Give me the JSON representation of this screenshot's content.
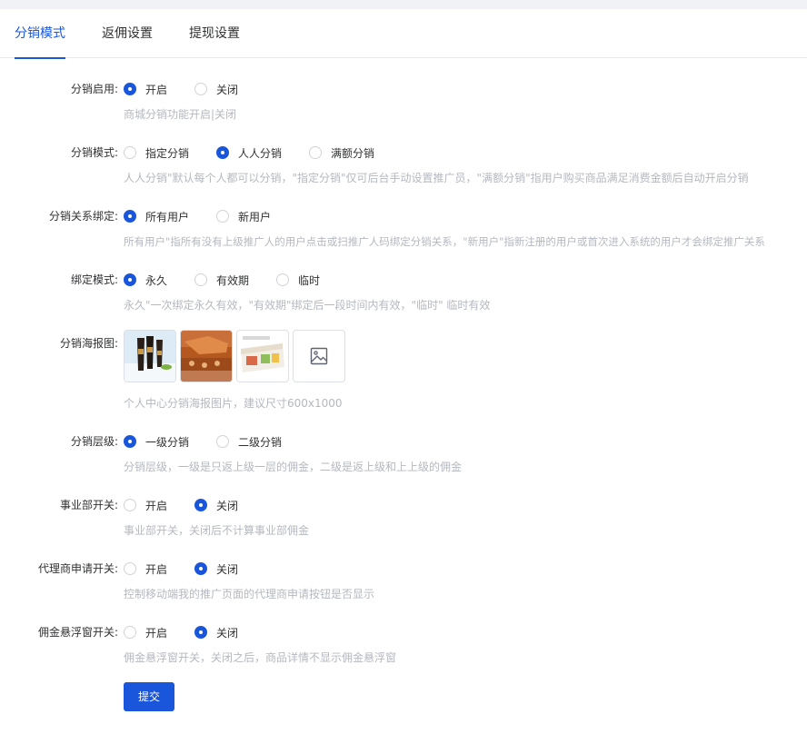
{
  "tabs": [
    {
      "label": "分销模式",
      "active": true
    },
    {
      "label": "返佣设置",
      "active": false
    },
    {
      "label": "提现设置",
      "active": false
    }
  ],
  "form": {
    "enable": {
      "label": "分销启用:",
      "options": [
        "开启",
        "关闭"
      ],
      "selected": 0,
      "hint": "商城分销功能开启|关闭"
    },
    "mode": {
      "label": "分销模式:",
      "options": [
        "指定分销",
        "人人分销",
        "满额分销"
      ],
      "selected": 1,
      "hint": "人人分销\"默认每个人都可以分销，\"指定分销\"仅可后台手动设置推广员，\"满额分销\"指用户购买商品满足消费金额后自动开启分销"
    },
    "binding": {
      "label": "分销关系绑定:",
      "options": [
        "所有用户",
        "新用户"
      ],
      "selected": 0,
      "hint": "所有用户\"指所有没有上级推广人的用户点击或扫推广人码绑定分销关系，\"新用户\"指新注册的用户或首次进入系统的用户才会绑定推广关系"
    },
    "bind_mode": {
      "label": "绑定模式:",
      "options": [
        "永久",
        "有效期",
        "临时"
      ],
      "selected": 0,
      "hint": "永久\"一次绑定永久有效，\"有效期\"绑定后一段时间内有效，\"临时\" 临时有效"
    },
    "poster": {
      "label": "分销海报图:",
      "hint": "个人中心分销海报图片，建议尺寸600x1000"
    },
    "level": {
      "label": "分销层级:",
      "options": [
        "一级分销",
        "二级分销"
      ],
      "selected": 0,
      "hint": "分销层级，一级是只返上级一层的佣金，二级是返上级和上上级的佣金"
    },
    "division": {
      "label": "事业部开关:",
      "options": [
        "开启",
        "关闭"
      ],
      "selected": 1,
      "hint": "事业部开关，关闭后不计算事业部佣金"
    },
    "agent": {
      "label": "代理商申请开关:",
      "options": [
        "开启",
        "关闭"
      ],
      "selected": 1,
      "hint": "控制移动端我的推广页面的代理商申请按钮是否显示"
    },
    "float": {
      "label": "佣金悬浮窗开关:",
      "options": [
        "开启",
        "关闭"
      ],
      "selected": 1,
      "hint": "佣金悬浮窗开关，关闭之后，商品详情不显示佣金悬浮窗"
    }
  },
  "submit_label": "提交",
  "colors": {
    "primary": "#1a56db",
    "hint": "#b4b8bf",
    "text": "#303133"
  },
  "icons": {
    "upload": "image-upload-icon"
  }
}
